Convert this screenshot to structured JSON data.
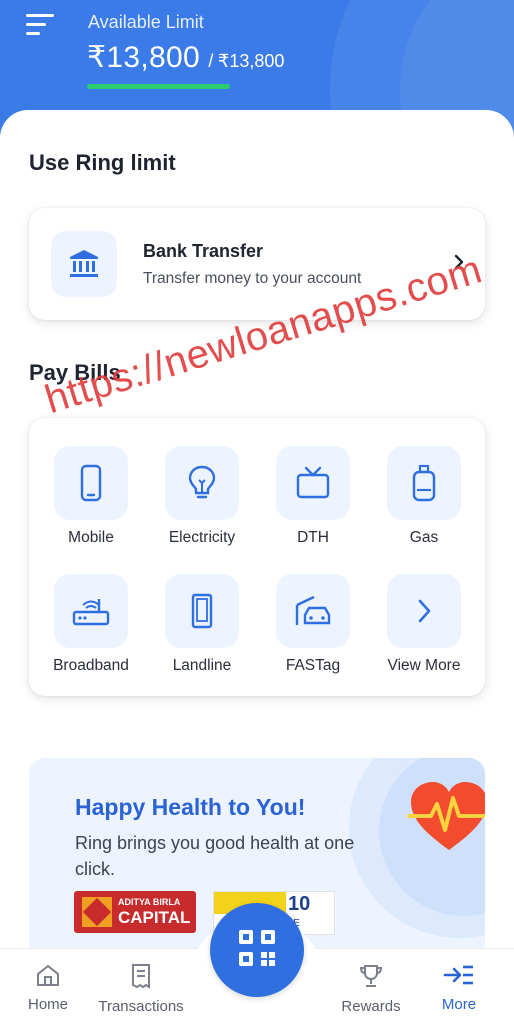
{
  "header": {
    "available_label": "Available Limit",
    "available_amount": "₹13,800",
    "separator": "/",
    "total_amount": "₹13,800",
    "usage_fraction": 1.0,
    "bar_color": "#2ecc71",
    "background_color": "#3a7be8"
  },
  "use_limit": {
    "title": "Use Ring limit",
    "bank_transfer": {
      "title": "Bank Transfer",
      "subtitle": "Transfer money to your account",
      "icon": "bank-icon",
      "action_icon": "chevron-right-icon"
    }
  },
  "pay_bills": {
    "title": "Pay Bills",
    "items": [
      {
        "label": "Mobile",
        "icon": "mobile-icon"
      },
      {
        "label": "Electricity",
        "icon": "bulb-icon"
      },
      {
        "label": "DTH",
        "icon": "tv-icon"
      },
      {
        "label": "Gas",
        "icon": "gas-cylinder-icon"
      },
      {
        "label": "Broadband",
        "icon": "router-icon"
      },
      {
        "label": "Landline",
        "icon": "landline-icon"
      },
      {
        "label": "FASTag",
        "icon": "fastag-icon"
      },
      {
        "label": "View More",
        "icon": "chevron-right-icon"
      }
    ]
  },
  "watermark": "https://newloanapps.com",
  "promo": {
    "title": "Happy Health to You!",
    "text": "Ring brings you good health at one click.",
    "partners": [
      {
        "name": "ADITYA BIRLA",
        "sub": "CAPITAL"
      },
      {
        "name": "10",
        "sub": "ANCE"
      }
    ],
    "icon": "heart-pulse-icon"
  },
  "bottom_nav": {
    "items": [
      {
        "label": "Home",
        "icon": "home-icon"
      },
      {
        "label": "Transactions",
        "icon": "receipt-icon"
      },
      {
        "label": "Rewards",
        "icon": "trophy-icon"
      },
      {
        "label": "More",
        "icon": "more-arrow-icon",
        "active": true
      }
    ],
    "center_button": {
      "icon": "qr-code-icon"
    }
  },
  "colors": {
    "primary": "#2f6fe0",
    "accent_text": "#2a63d4",
    "tile_bg": "#edf4ff"
  }
}
